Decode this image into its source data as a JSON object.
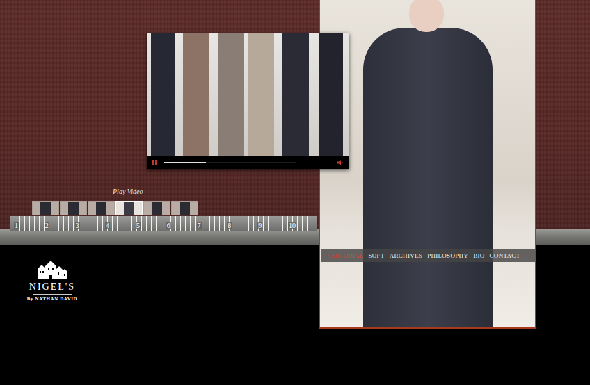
{
  "logo": {
    "title": "NIGEL'S",
    "subtitle": "By NATHAN DAVID"
  },
  "video": {
    "playing": true,
    "level": 0.32
  },
  "play_video": "Play Video",
  "thumbnails": [
    {
      "selected": false
    },
    {
      "selected": false
    },
    {
      "selected": false
    },
    {
      "selected": true
    },
    {
      "selected": false
    },
    {
      "selected": false
    }
  ],
  "ruler": [
    "1",
    "2",
    "3",
    "4",
    "5",
    "6",
    "7",
    "8",
    "9",
    "10"
  ],
  "nav": [
    {
      "label": "SARTORIAL",
      "selected": true
    },
    {
      "label": "SOFT",
      "selected": false
    },
    {
      "label": "ARCHIVES",
      "selected": false
    },
    {
      "label": "PHILOSOPHY",
      "selected": false
    },
    {
      "label": "BIO",
      "selected": false
    },
    {
      "label": "CONTACT",
      "selected": false
    }
  ]
}
